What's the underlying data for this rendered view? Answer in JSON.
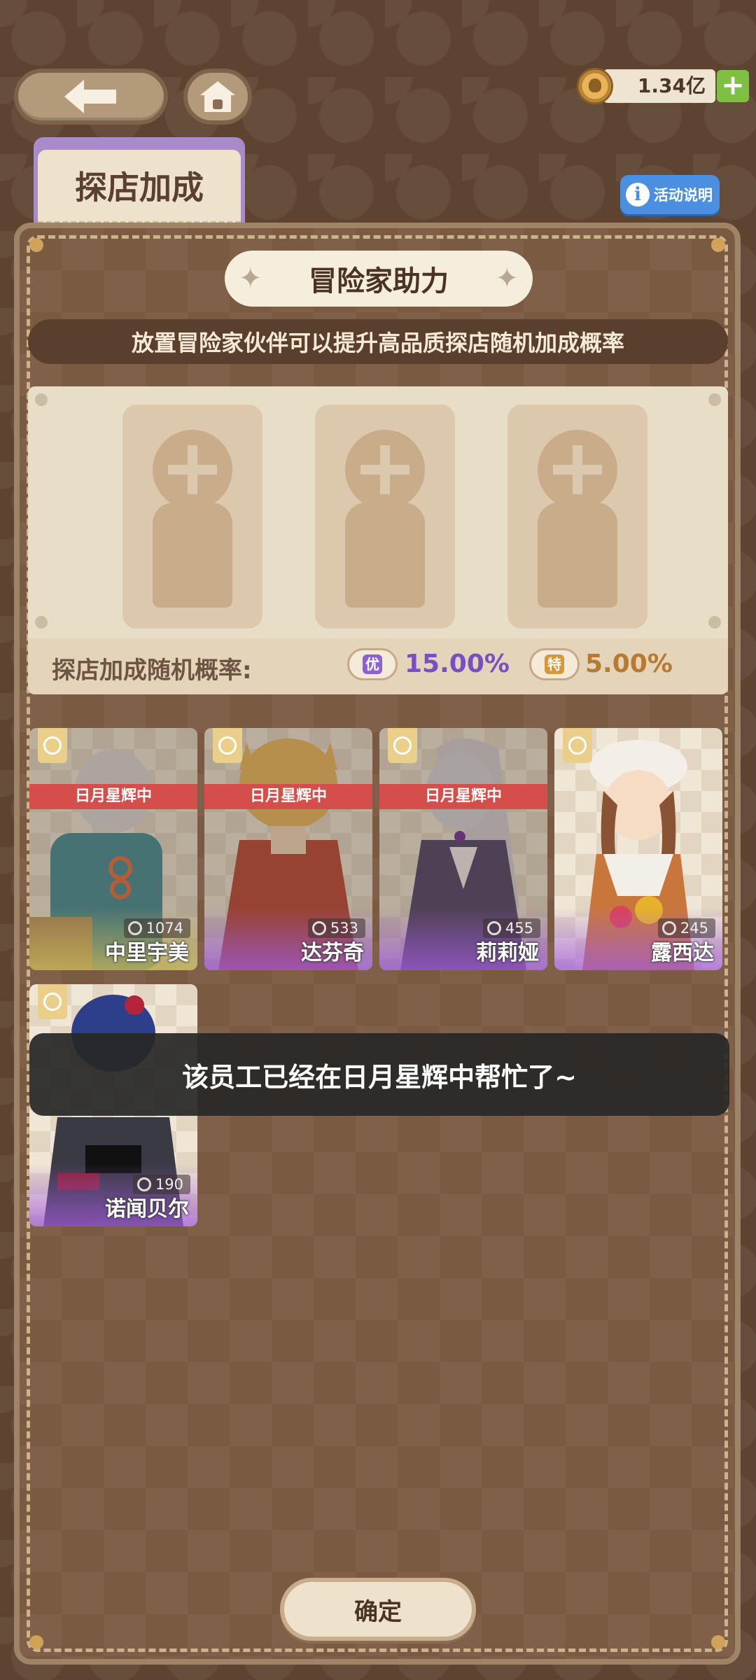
{
  "header": {
    "back_icon": "arrow-left-icon",
    "home_icon": "home-icon",
    "coins": {
      "icon": "coin-icon",
      "amount": "1.34亿",
      "add_label": "+"
    }
  },
  "tab": {
    "label": "探店加成"
  },
  "help": {
    "label": "活动说明",
    "icon_text": "i"
  },
  "panel": {
    "title": "冒险家助力",
    "subtitle": "放置冒险家伙伴可以提升高品质探店随机加成概率",
    "slot_count": 3,
    "rate_label": "探店加成随机概率:",
    "rates": [
      {
        "tag": "优",
        "value": "15.00%",
        "color": "#7a4fc4"
      },
      {
        "tag": "特",
        "value": "5.00%",
        "color": "#b77a2f"
      }
    ]
  },
  "characters": [
    {
      "name": "中里宇美",
      "power": "1074",
      "status": "日月星辉中",
      "busy": true,
      "tint": "gold"
    },
    {
      "name": "达芬奇",
      "power": "533",
      "status": "日月星辉中",
      "busy": true,
      "tint": "purple"
    },
    {
      "name": "莉莉娅",
      "power": "455",
      "status": "日月星辉中",
      "busy": true,
      "tint": "purple"
    },
    {
      "name": "露西达",
      "power": "245",
      "status": "",
      "busy": false,
      "tint": "purple"
    },
    {
      "name": "诺闻贝尔",
      "power": "190",
      "status": "",
      "busy": false,
      "tint": "purple"
    }
  ],
  "toast": {
    "message": "该员工已经在日月星辉中帮忙了~"
  },
  "footer": {
    "confirm_label": "确定"
  },
  "colors": {
    "accent_red": "#d44f4b",
    "help_blue": "#4b8fe0",
    "coin_add_green": "#7ec142"
  }
}
